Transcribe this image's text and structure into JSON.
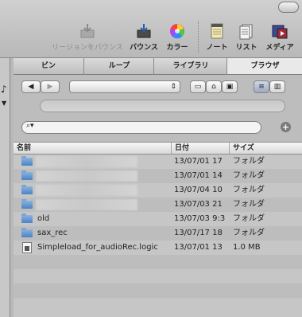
{
  "toolbar": {
    "bounce_region": "リージョンをバウンス",
    "bounce": "バウンス",
    "colors": "カラー",
    "notes": "ノート",
    "lists": "リスト",
    "media": "メディア"
  },
  "tabs": [
    "ビン",
    "ループ",
    "ライブラリ",
    "ブラウザ"
  ],
  "active_tab": "ブラウザ",
  "table": {
    "headers": [
      "名前",
      "日付",
      "サイズ"
    ],
    "rows": [
      {
        "name": "",
        "date": "13/07/01 17",
        "size": "フォルダ",
        "type": "folder"
      },
      {
        "name": "",
        "date": "13/07/01 14",
        "size": "フォルダ",
        "type": "folder"
      },
      {
        "name": "",
        "date": "13/07/04 10",
        "size": "フォルダ",
        "type": "folder"
      },
      {
        "name": "",
        "date": "13/07/03 21",
        "size": "フォルダ",
        "type": "folder"
      },
      {
        "name": "old",
        "date": "13/07/03 9:3",
        "size": "フォルダ",
        "type": "folder"
      },
      {
        "name": "sax_rec",
        "date": "13/07/17 18",
        "size": "フォルダ",
        "type": "folder"
      },
      {
        "name": "Simpleload_for_audioRec.logic",
        "date": "13/07/01 13",
        "size": "1.0 MB",
        "type": "file"
      }
    ]
  }
}
